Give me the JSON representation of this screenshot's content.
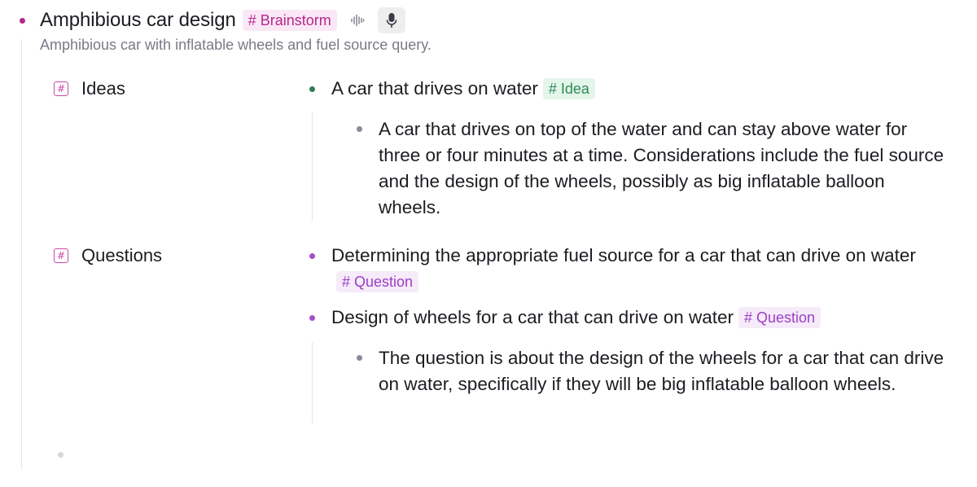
{
  "note": {
    "title": "Amphibious car design",
    "tag": "# Brainstorm",
    "summary": "Amphibious car with inflatable wheels and fuel source query.",
    "waveform_icon": "audio-waveform-icon",
    "mic_icon": "microphone-icon"
  },
  "fields": [
    {
      "label": "Ideas",
      "icon": "hash-field-icon",
      "items": [
        {
          "text": "A car that drives on water",
          "tag": "# Idea",
          "children": [
            "A car that drives on top of the water and can stay above water for three or four minutes at a time. Considerations include the fuel source and the design of the wheels, possibly as big inflatable balloon wheels."
          ]
        }
      ]
    },
    {
      "label": "Questions",
      "icon": "hash-field-icon",
      "items": [
        {
          "text": "Determining the appropriate fuel source for a car that can drive on water",
          "tag": "# Question",
          "children": []
        },
        {
          "text": "Design of wheels for a car that can drive on water",
          "tag": "# Question",
          "children": [
            "The question is about the design of the wheels for a car that can drive on water, specifically if they will be big inflatable balloon wheels."
          ]
        }
      ]
    }
  ],
  "colors": {
    "brainstorm_tag": "#b5278e",
    "idea_tag": "#2e8b57",
    "question_tag": "#9b3fc4",
    "field_icon": "#c84aa7"
  }
}
